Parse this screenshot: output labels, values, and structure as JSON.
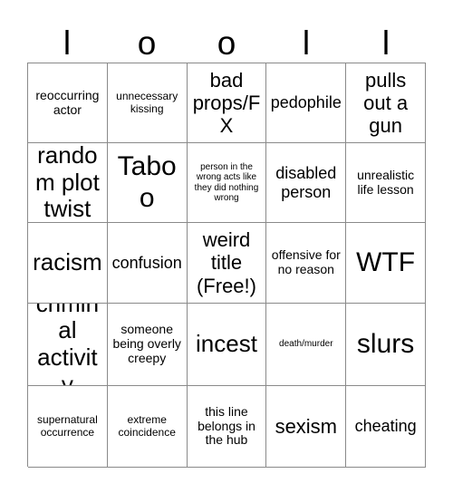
{
  "card": {
    "header_letters": [
      "l",
      "o",
      "o",
      "l",
      "l"
    ],
    "columns": 5,
    "rows": 5,
    "border_color": "#8a8a8a",
    "background_color": "#ffffff",
    "text_color": "#000000",
    "free_space_label": "weird title (Free!)",
    "cells": [
      {
        "text": "reoccurring actor",
        "size": "sm"
      },
      {
        "text": "unnecessary kissing",
        "size": "xs"
      },
      {
        "text": "bad props/FX",
        "size": "lg"
      },
      {
        "text": "pedophile",
        "size": "md"
      },
      {
        "text": "pulls out a gun",
        "size": "lg"
      },
      {
        "text": "random plot twist",
        "size": "xl"
      },
      {
        "text": "Taboo",
        "size": "xxl"
      },
      {
        "text": "person in the wrong acts like they did nothing wrong",
        "size": "xxs"
      },
      {
        "text": "disabled person",
        "size": "md"
      },
      {
        "text": "unrealistic life lesson",
        "size": "sm"
      },
      {
        "text": "racism",
        "size": "xl"
      },
      {
        "text": "confusion",
        "size": "md"
      },
      {
        "text": "weird title (Free!)",
        "size": "lg"
      },
      {
        "text": "offensive for no reason",
        "size": "sm"
      },
      {
        "text": "WTF",
        "size": "xxl"
      },
      {
        "text": "criminal activity",
        "size": "xl"
      },
      {
        "text": "someone being overly creepy",
        "size": "sm"
      },
      {
        "text": "incest",
        "size": "xl"
      },
      {
        "text": "death/murder",
        "size": "xxs"
      },
      {
        "text": "slurs",
        "size": "xxl"
      },
      {
        "text": "supernatural occurrence",
        "size": "xs"
      },
      {
        "text": "extreme coincidence",
        "size": "xs"
      },
      {
        "text": "this line belongs in the hub",
        "size": "sm"
      },
      {
        "text": "sexism",
        "size": "lg"
      },
      {
        "text": "cheating",
        "size": "md"
      }
    ]
  }
}
